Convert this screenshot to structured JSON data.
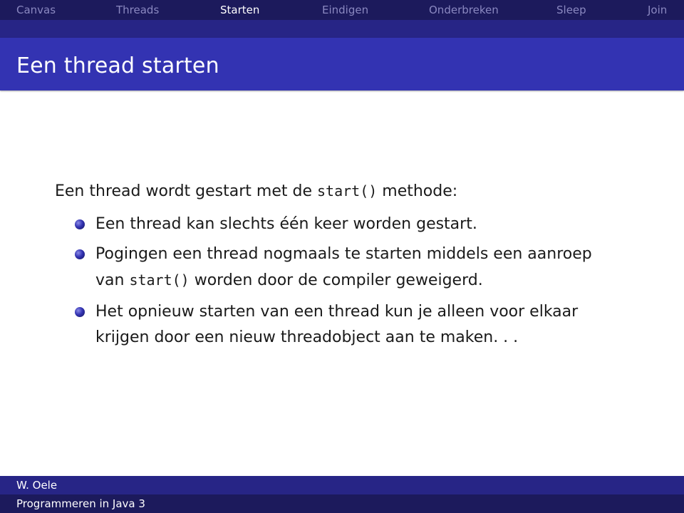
{
  "nav": {
    "items": [
      {
        "label": "Canvas",
        "active": false
      },
      {
        "label": "Threads",
        "active": false
      },
      {
        "label": "Starten",
        "active": true
      },
      {
        "label": "Eindigen",
        "active": false
      },
      {
        "label": "Onderbreken",
        "active": false
      },
      {
        "label": "Sleep",
        "active": false
      },
      {
        "label": "Join",
        "active": false
      }
    ]
  },
  "slide": {
    "title": "Een thread starten",
    "intro": {
      "before": "Een thread wordt gestart met de ",
      "code": "start()",
      "after": " methode:"
    },
    "bullets": [
      {
        "line1": "Een thread kan slechts één keer worden gestart."
      },
      {
        "line1": "Pogingen een thread nogmaals te starten middels een aanroep",
        "line2_before": "van ",
        "line2_code": "start()",
        "line2_after": " worden door de compiler geweigerd."
      },
      {
        "line1": "Het opnieuw starten van een thread kun je alleen voor elkaar",
        "line2": "krijgen door een nieuw threadobject aan te maken. . ."
      }
    ],
    "bullet_icon": "ball-bullet-icon"
  },
  "footer": {
    "author": "W. Oele",
    "course": "Programmeren in Java 3"
  },
  "colors": {
    "nav_bg": "#1c1a5c",
    "nav_inactive_text": "#8a88c0",
    "nav_active_text": "#ffffff",
    "subband_bg": "#272586",
    "title_bg": "#3333b2",
    "footer_author_bg": "#272586",
    "footer_course_bg": "#1c1a5c"
  }
}
